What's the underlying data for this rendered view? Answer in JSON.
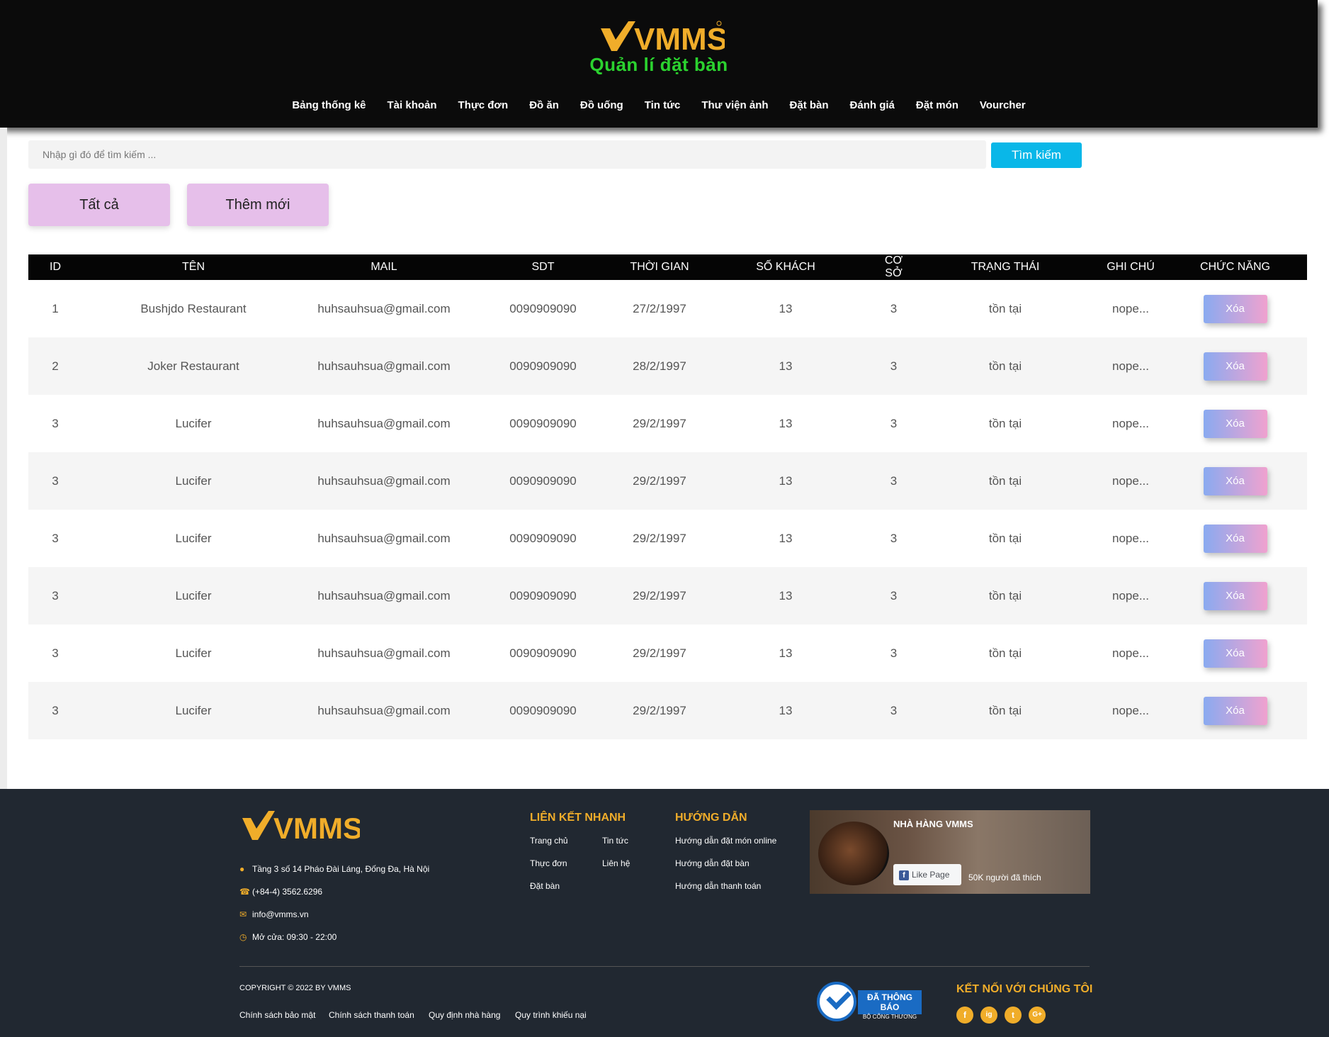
{
  "header": {
    "brand": "VMMS",
    "subtitle": "Quản lí đặt bàn",
    "nav": [
      "Bảng thống kê",
      "Tài khoản",
      "Thực đơn",
      "Đồ ăn",
      "Đồ uống",
      "Tin tức",
      "Thư viện ảnh",
      "Đặt bàn",
      "Đánh giá",
      "Đặt món",
      "Vourcher"
    ]
  },
  "search": {
    "placeholder": "Nhập gì đó để tìm kiếm ...",
    "button": "Tìm kiếm"
  },
  "filters": {
    "all": "Tất cả",
    "add_new": "Thêm mới"
  },
  "table": {
    "headers": [
      "ID",
      "TÊN",
      "MAIL",
      "SDT",
      "THỜI GIAN",
      "SỐ KHÁCH",
      "CƠ SỞ",
      "TRẠNG THÁI",
      "GHI CHÚ",
      "CHỨC NĂNG"
    ],
    "rows": [
      {
        "id": "1",
        "name": "Bushjdo Restaurant",
        "mail": "huhsauhsua@gmail.com",
        "sdt": "0090909090",
        "time": "27/2/1997",
        "guests": "13",
        "branch": "3",
        "status": "tồn tại",
        "note": "nope...",
        "action": "Xóa"
      },
      {
        "id": "2",
        "name": "Joker Restaurant",
        "mail": "huhsauhsua@gmail.com",
        "sdt": "0090909090",
        "time": "28/2/1997",
        "guests": "13",
        "branch": "3",
        "status": "tồn tại",
        "note": "nope...",
        "action": "Xóa"
      },
      {
        "id": "3",
        "name": "Lucifer",
        "mail": "huhsauhsua@gmail.com",
        "sdt": "0090909090",
        "time": "29/2/1997",
        "guests": "13",
        "branch": "3",
        "status": "tồn tại",
        "note": "nope...",
        "action": "Xóa"
      },
      {
        "id": "3",
        "name": "Lucifer",
        "mail": "huhsauhsua@gmail.com",
        "sdt": "0090909090",
        "time": "29/2/1997",
        "guests": "13",
        "branch": "3",
        "status": "tồn tại",
        "note": "nope...",
        "action": "Xóa"
      },
      {
        "id": "3",
        "name": "Lucifer",
        "mail": "huhsauhsua@gmail.com",
        "sdt": "0090909090",
        "time": "29/2/1997",
        "guests": "13",
        "branch": "3",
        "status": "tồn tại",
        "note": "nope...",
        "action": "Xóa"
      },
      {
        "id": "3",
        "name": "Lucifer",
        "mail": "huhsauhsua@gmail.com",
        "sdt": "0090909090",
        "time": "29/2/1997",
        "guests": "13",
        "branch": "3",
        "status": "tồn tại",
        "note": "nope...",
        "action": "Xóa"
      },
      {
        "id": "3",
        "name": "Lucifer",
        "mail": "huhsauhsua@gmail.com",
        "sdt": "0090909090",
        "time": "29/2/1997",
        "guests": "13",
        "branch": "3",
        "status": "tồn tại",
        "note": "nope...",
        "action": "Xóa"
      },
      {
        "id": "3",
        "name": "Lucifer",
        "mail": "huhsauhsua@gmail.com",
        "sdt": "0090909090",
        "time": "29/2/1997",
        "guests": "13",
        "branch": "3",
        "status": "tồn tại",
        "note": "nope...",
        "action": "Xóa"
      }
    ]
  },
  "footer": {
    "address": "Tầng 3 số 14 Pháo Đài Láng, Đống Đa, Hà Nội",
    "phone": "(+84-4) 3562.6296",
    "email": "info@vmms.vn",
    "hours": "Mở cửa: 09:30 - 22:00",
    "quick_links_title": "LIÊN KẾT NHANH",
    "quick_links": [
      "Trang chủ",
      "Tin tức",
      "Thực đơn",
      "Liên hệ",
      "Đặt bàn"
    ],
    "guide_title": "HƯỚNG DẪN",
    "guides": [
      "Hướng dẫn đặt món online",
      "Hướng dẫn đặt bàn",
      "Hướng dẫn thanh toán"
    ],
    "fb_name": "NHÀ HÀNG VMMS",
    "fb_like": "Like Page",
    "fb_count": "50K người đã thích",
    "copyright": "COPYRIGHT © 2022 BY VMMS",
    "policies": [
      "Chính sách bảo mật",
      "Chính sách thanh toán",
      "Quy định nhà hàng",
      "Quy trình khiếu nại"
    ],
    "badge_title": "ĐÃ THÔNG BÁO",
    "badge_sub": "BỘ CÔNG THƯƠNG",
    "connect_title": "KẾT NỐI VỚI CHÚNG TÔI",
    "social": [
      "f",
      "ig",
      "t",
      "G+"
    ]
  },
  "colors": {
    "accent": "#f0ad2a",
    "subtitle": "#2bd22f",
    "search_button": "#09b7e8",
    "pill": "#e6bfea"
  }
}
